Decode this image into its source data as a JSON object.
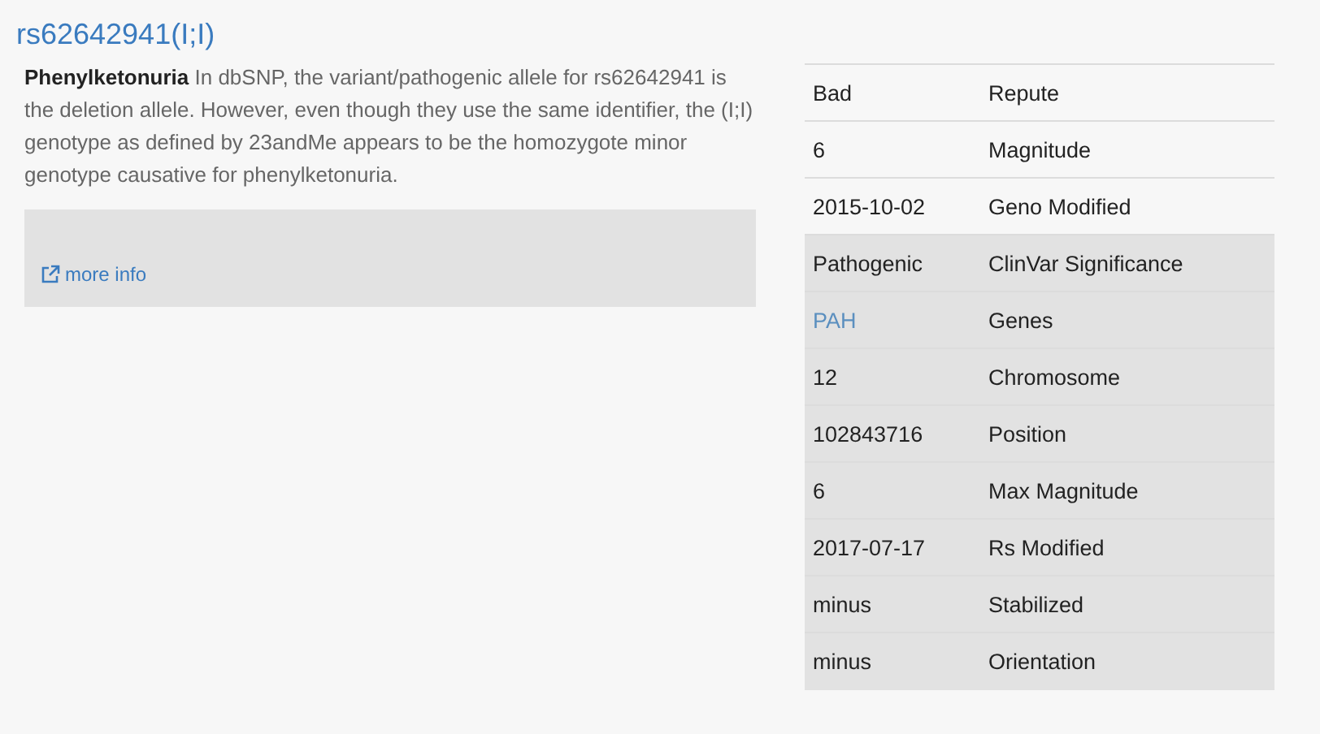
{
  "title": "rs62642941(I;I)",
  "summary": {
    "text": "**Phenylketonuria** In dbSNP, the variant/pathogenic allele for rs62642941 is the deletion allele. However, even though they use the same identifier, the (I;I) genotype as defined by 23andMe appears to be the homozygote minor genotype causative for phenylketonuria."
  },
  "more_info": {
    "label": "more info"
  },
  "facts": [
    {
      "value": "Bad",
      "label": "Repute",
      "shaded": false,
      "link": false
    },
    {
      "value": "6",
      "label": "Magnitude",
      "shaded": false,
      "link": false
    },
    {
      "value": "2015-10-02",
      "label": "Geno Modified",
      "shaded": false,
      "link": false
    },
    {
      "value": "Pathogenic",
      "label": "ClinVar Significance",
      "shaded": true,
      "link": false
    },
    {
      "value": "PAH",
      "label": "Genes",
      "shaded": true,
      "link": true
    },
    {
      "value": "12",
      "label": "Chromosome",
      "shaded": true,
      "link": false
    },
    {
      "value": "102843716",
      "label": "Position",
      "shaded": true,
      "link": false
    },
    {
      "value": "6",
      "label": "Max Magnitude",
      "shaded": true,
      "link": false
    },
    {
      "value": "2017-07-17",
      "label": "Rs Modified",
      "shaded": true,
      "link": false
    },
    {
      "value": "minus",
      "label": "Stabilized",
      "shaded": true,
      "link": false
    },
    {
      "value": "minus",
      "label": "Orientation",
      "shaded": true,
      "link": false
    }
  ]
}
